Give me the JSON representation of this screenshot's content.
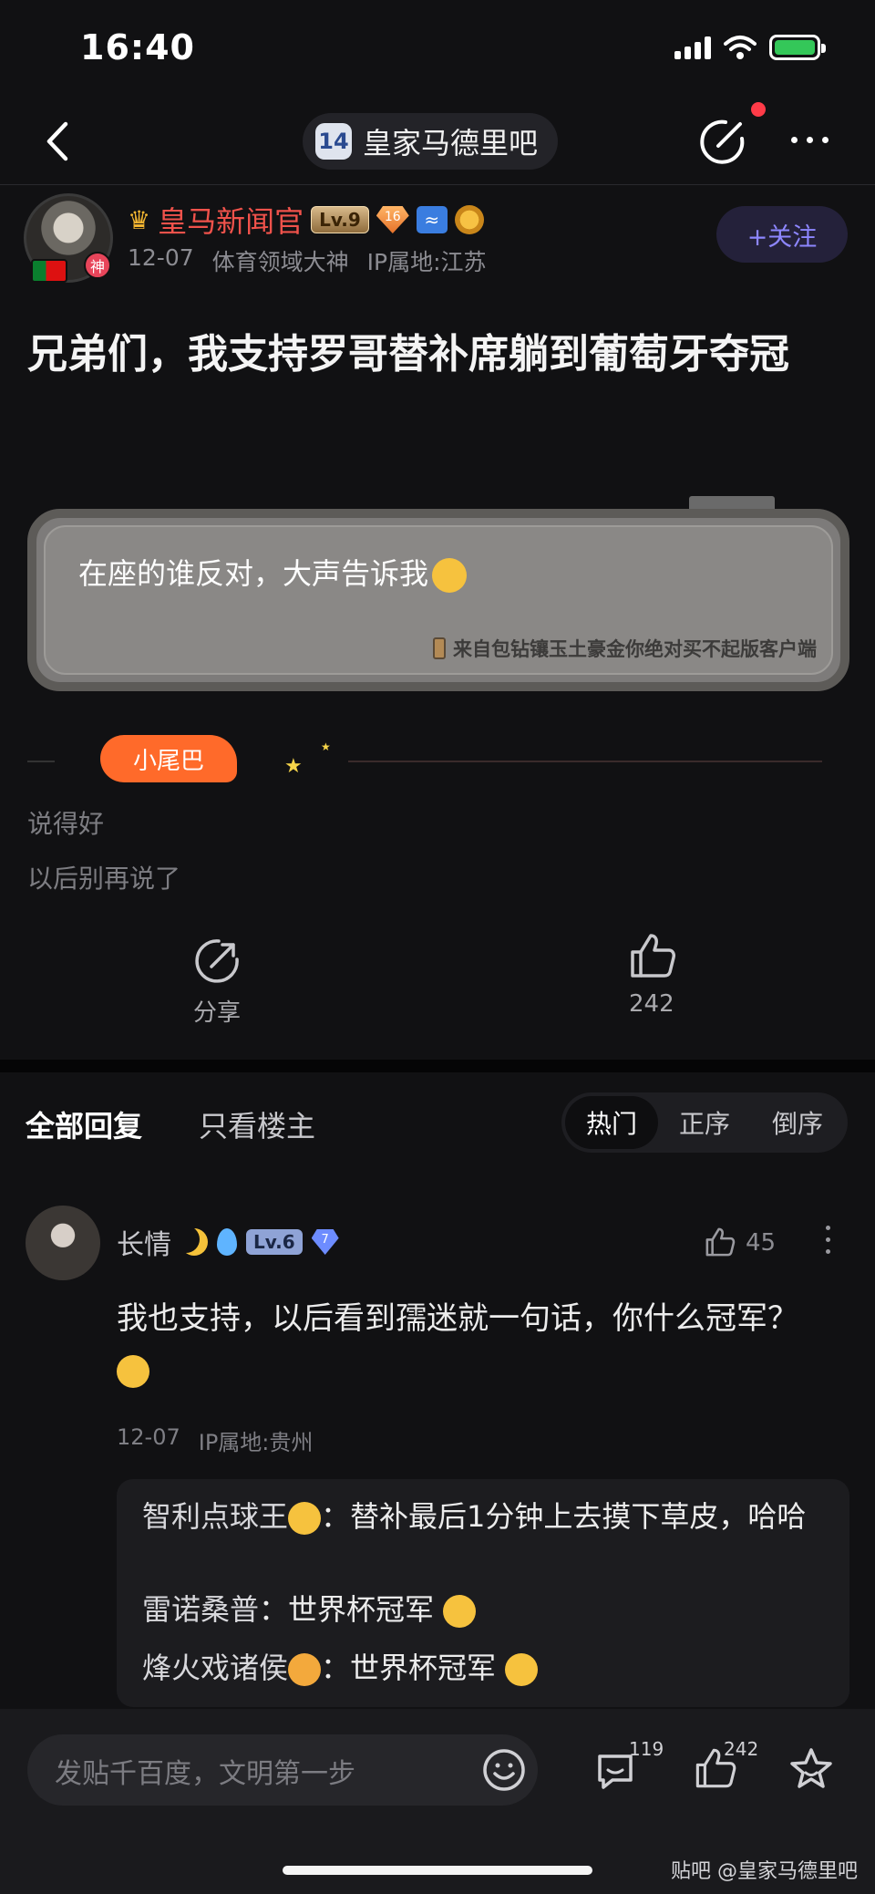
{
  "status": {
    "time": "16:40"
  },
  "nav": {
    "forum_logo": "14",
    "forum_name": "皇家马德里吧"
  },
  "author": {
    "name": "皇马新闻官",
    "level": "Lv.9",
    "gem_level": "16",
    "badge_text": "神",
    "date": "12-07",
    "title": "体育领域大神",
    "ip": "IP属地:江苏",
    "follow_label": "+关注"
  },
  "post": {
    "title": "兄弟们，我支持罗哥替补席躺到葡萄牙夺冠",
    "bubble_text": "在座的谁反对，大声告诉我",
    "bubble_source": "来自包钻镶玉土豪金你绝对买不起版客户端",
    "tail_label": "小尾巴",
    "tail_line1": "说得好",
    "tail_line2": "以后别再说了",
    "share_label": "分享",
    "like_count": "242"
  },
  "replies_tabs": {
    "all": "全部回复",
    "op_only": "只看楼主",
    "sort": [
      "热门",
      "正序",
      "倒序"
    ],
    "active_sort": "热门"
  },
  "reply": {
    "name": "长情",
    "level": "Lv.6",
    "gem_level": "7",
    "like_count": "45",
    "content": "我也支持，以后看到孺迷就一句话，你什么冠军？",
    "date": "12-07",
    "ip": "IP属地:贵州",
    "subs": [
      {
        "name": "智利点球王",
        "text": "：替补最后1分钟上去摸下草皮，哈哈"
      },
      {
        "name": "雷诺桑普",
        "text": "：世界杯冠军"
      },
      {
        "name": "烽火戏诸侯",
        "text": "：世界杯冠军"
      }
    ]
  },
  "bottom": {
    "input_placeholder": "发贴千百度，文明第一步",
    "comment_count": "119",
    "like_count": "242",
    "watermark": "贴吧 @皇家马德里吧"
  },
  "colors": {
    "background": "#111113",
    "author_name": "#f0524b",
    "follow_text": "#8d86ff",
    "tail_badge": "#ff6a2a",
    "battery": "#34c759",
    "notify_dot": "#ff3b48"
  }
}
